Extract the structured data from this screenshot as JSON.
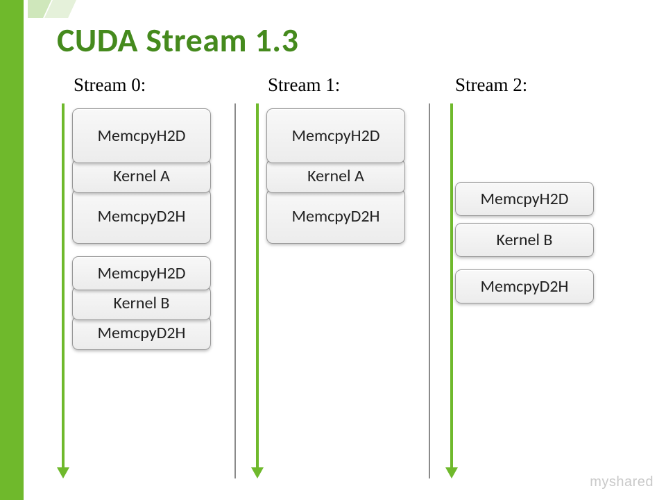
{
  "title": "CUDA Stream 1.3",
  "watermark": "myshared",
  "colors": {
    "accent": "#6fb92c",
    "title": "#458a1d"
  },
  "streams": [
    {
      "label": "Stream 0:",
      "ops": [
        {
          "label": "MemcpyH2D"
        },
        {
          "label": "Kernel A"
        },
        {
          "label": "MemcpyD2H"
        },
        {
          "label": "MemcpyH2D"
        },
        {
          "label": "Kernel B"
        },
        {
          "label": "MemcpyD2H"
        }
      ]
    },
    {
      "label": "Stream 1:",
      "ops": [
        {
          "label": "MemcpyH2D"
        },
        {
          "label": "Kernel A"
        },
        {
          "label": "MemcpyD2H"
        }
      ]
    },
    {
      "label": "Stream 2:",
      "ops": [
        {
          "label": "MemcpyH2D"
        },
        {
          "label": "Kernel B"
        },
        {
          "label": "MemcpyD2H"
        }
      ]
    }
  ]
}
